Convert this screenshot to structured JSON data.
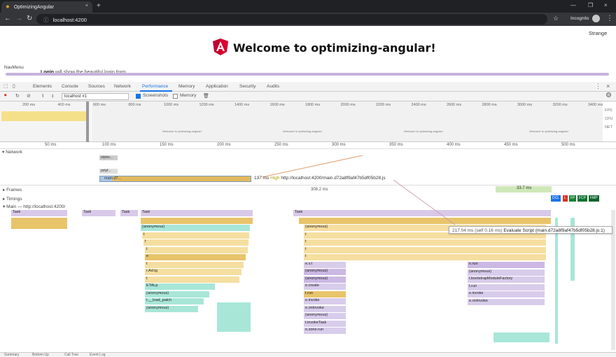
{
  "browser": {
    "tab_title": "OptimizingAngular",
    "url": "localhost:4200",
    "profile_label": "Incognito",
    "new_tab": "+",
    "close_glyph": "×"
  },
  "page": {
    "heading": "Welcome to optimizing-angular!",
    "top_right": "Strange",
    "nav_label": "NavMenu",
    "login_bold": "Login",
    "login_rest": "will show the beautiful login form"
  },
  "devtools": {
    "tabs": [
      "Elements",
      "Console",
      "Sources",
      "Network",
      "Performance",
      "Memory",
      "Application",
      "Security",
      "Audits"
    ],
    "active_tab": "Performance",
    "profile": "localhost #1",
    "screenshots_label": "Screenshots",
    "memory_label": "Memory",
    "overview_ticks": [
      "200 ms",
      "400 ms",
      "600 ms",
      "800 ms",
      "1000 ms",
      "1200 ms",
      "1400 ms",
      "1600 ms",
      "1800 ms",
      "2000 ms",
      "2200 ms",
      "2400 ms",
      "2600 ms",
      "2800 ms",
      "3000 ms",
      "3200 ms",
      "3400 ms"
    ],
    "overview_side": [
      "FPS",
      "CPU",
      "NET"
    ],
    "screenshot_caption": "Welcome to optimizing-angular!",
    "ruler_ticks": [
      "50 ms",
      "100 ms",
      "150 ms",
      "200 ms",
      "250 ms",
      "300 ms",
      "350 ms",
      "400 ms",
      "450 ms",
      "500 ms"
    ],
    "network_label": "Network",
    "net_row1": "styles...",
    "net_row2": "polyf...",
    "net_main_file": "main.d7...",
    "net_tooltip_time": "137 ms",
    "net_tooltip_priority": "High",
    "net_tooltip_url": "http://localhost:4200/main.d72a8f9af47b5df05b28.js",
    "frames_label": "Frames",
    "frames_value": "308.2 ms",
    "frames_green": "33.7 ms",
    "timings_label": "Timings",
    "main_label": "Main — http://localhost:4200/",
    "markers": [
      "DCL",
      "L",
      "FP",
      "FCP",
      "FMP"
    ],
    "task_label": "Task",
    "hover_tip_time": "217.04 ms (self 0.16 ms)",
    "hover_tip_text": "Evaluate Script (main.d72a8f9af47b5df05b28.js:1)",
    "flame_left": [
      "(anonymous)",
      "t",
      "t",
      "t",
      "e",
      "t",
      "r.Ad.tg",
      "t",
      "ETALp",
      "(anonymous)",
      "t.__load_patch",
      "(anonymous)"
    ],
    "flame_right": [
      "(anonymous)",
      "t",
      "t",
      "t",
      "t",
      "e.v.t",
      "(anonymous)",
      "(anonymous)",
      "e.create",
      "t.run",
      "e.invoke",
      "e.onInvoke",
      "(anonymous)",
      "t.invokeTask",
      "e.zone.run"
    ],
    "flame_right2": [
      "n.run",
      "(anonymous)",
      "t.bootstrapModuleFactory",
      "t.run",
      "e.invoke",
      "e.onInvoke"
    ],
    "bottom_tabs": [
      "Summary",
      "Bottom-Up",
      "Call Tree",
      "Event Log"
    ]
  }
}
